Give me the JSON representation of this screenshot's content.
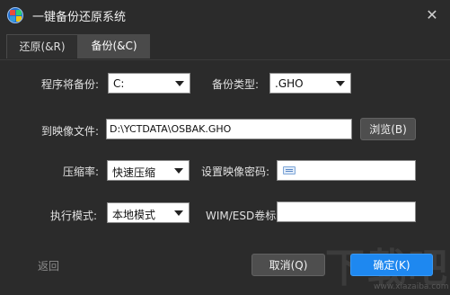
{
  "window": {
    "title": "一键备份还原系统",
    "close_glyph": "✕"
  },
  "tabs": [
    {
      "label": "还原(&R)",
      "active": false
    },
    {
      "label": "备份(&C)",
      "active": true
    }
  ],
  "form": {
    "program_backup_label": "程序将备份:",
    "program_backup_value": "C:",
    "backup_type_label": "备份类型:",
    "backup_type_value": ".GHO",
    "image_file_label": "到映像文件:",
    "image_file_value": "D:\\YCTDATA\\OSBAK.GHO",
    "browse_label": "浏览(B)",
    "compression_label": "压缩率:",
    "compression_value": "快速压缩",
    "set_password_label": "设置映像密码:",
    "password_value": "",
    "mode_label": "执行模式:",
    "mode_value": "本地模式",
    "wim_label": "WIM/ESD卷标:",
    "wim_value": ""
  },
  "footer": {
    "back_label": "返回",
    "cancel_label": "取消(Q)",
    "ok_label": "确定(K)"
  },
  "watermark": {
    "text": "下载吧",
    "url": "www.xiazaiba.com"
  },
  "colors": {
    "background": "#2b2b2b",
    "primary": "#1e88f0",
    "button": "#4e4e4e"
  }
}
